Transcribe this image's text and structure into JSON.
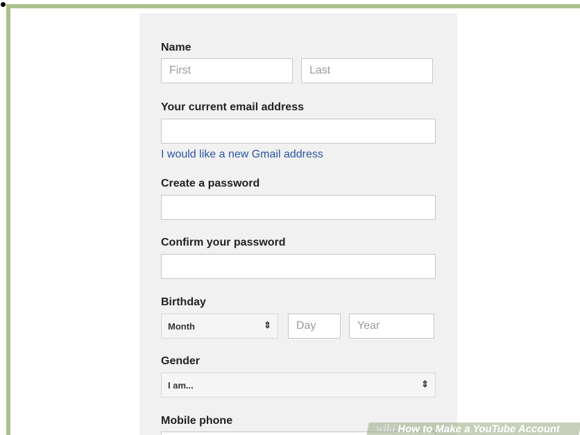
{
  "form": {
    "name_label": "Name",
    "first_placeholder": "First",
    "last_placeholder": "Last",
    "email_label": "Your current email address",
    "gmail_link": "I would like a new Gmail address",
    "password_label": "Create a password",
    "confirm_label": "Confirm your password",
    "birthday_label": "Birthday",
    "month_value": "Month",
    "day_placeholder": "Day",
    "year_placeholder": "Year",
    "gender_label": "Gender",
    "gender_value": "I am...",
    "mobile_label": "Mobile phone"
  },
  "icons": {
    "select_arrows": "⇕"
  },
  "watermark": {
    "brand": "wiki",
    "title": "How to Make a YouTube Account"
  },
  "colors": {
    "frame": "#a9c18d",
    "panel": "#f1f1f1",
    "link": "#2a55a2"
  }
}
